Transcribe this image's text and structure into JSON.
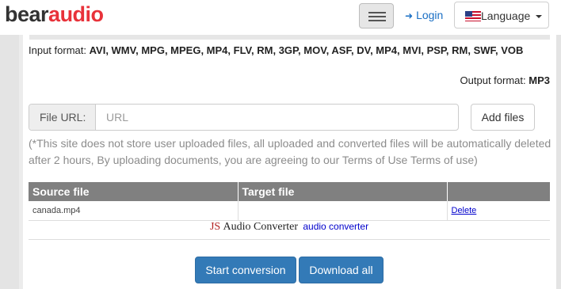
{
  "header": {
    "logo_part1": "bear",
    "logo_part2": "audio",
    "login_label": "Login",
    "language_label": "Language"
  },
  "formats": {
    "input_label": "Input format:",
    "input_list": "AVI, WMV, MPG, MPEG, MP4, FLV, RM, 3GP, MOV, ASF, DV, MP4, MVI, PSP, RM, SWF, VOB",
    "output_label": "Output format:",
    "output_value": "MP3"
  },
  "url": {
    "addon_label": "File URL:",
    "placeholder": "URL",
    "add_files_label": "Add files"
  },
  "notice": "(*This site does not store user uploaded files, all uploaded and converted files will be automatically deleted after 2 hours, By uploading documents, you are agreeing to our Terms of Use Terms of use)",
  "table": {
    "headers": [
      "Source file",
      "Target file",
      ""
    ],
    "rows": [
      {
        "source": "canada.mp4",
        "target": "",
        "action": "Delete"
      }
    ]
  },
  "promo": {
    "brand_js": "JS",
    "brand_name": "Audio Converter",
    "link_text": "audio converter"
  },
  "buttons": {
    "start_label": "Start conversion",
    "download_label": "Download all"
  },
  "colors": {
    "brand_red": "#e8323a",
    "primary_blue": "#337ab7",
    "table_header": "#808080"
  }
}
